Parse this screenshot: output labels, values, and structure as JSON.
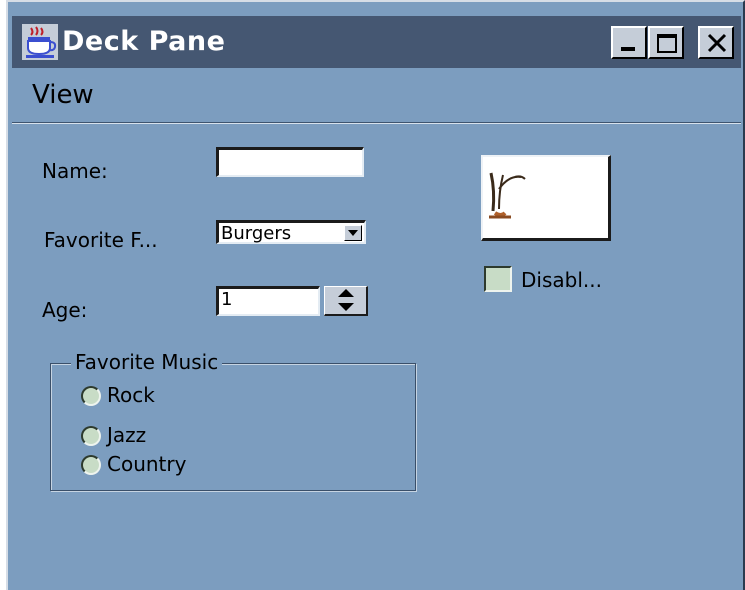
{
  "window": {
    "title": "Deck Pane",
    "app_icon": "java-coffee-cup-icon",
    "controls": {
      "minimize_icon": "minimize-icon",
      "maximize_icon": "maximize-icon",
      "close_icon": "close-icon"
    }
  },
  "menubar": {
    "items": [
      {
        "label": "View"
      }
    ]
  },
  "form": {
    "name": {
      "label": "Name:",
      "value": ""
    },
    "favorite_food": {
      "label": "Favorite F...",
      "selected": "Burgers"
    },
    "age": {
      "label": "Age:",
      "value": "1"
    },
    "favorite_music": {
      "title": "Favorite Music",
      "options": [
        {
          "label": "Rock",
          "selected": false
        },
        {
          "label": "Jazz",
          "selected": false
        },
        {
          "label": "Country",
          "selected": false
        }
      ]
    }
  },
  "side": {
    "image_button_icon": "plant-sketch-icon",
    "disable_checkbox": {
      "label": "Disabl...",
      "checked": false
    }
  },
  "colors": {
    "window_background": "#7c9dbf",
    "titlebar": "#455772",
    "control_face": "#c5cdd8",
    "radio_fill": "#c8dcc6"
  }
}
